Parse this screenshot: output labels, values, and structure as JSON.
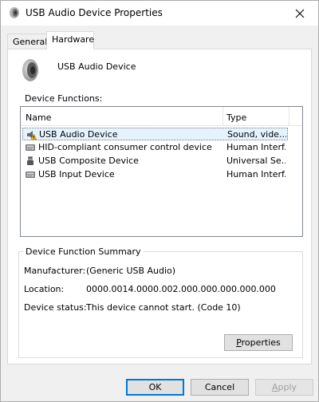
{
  "window": {
    "title": "USB Audio Device Properties",
    "title_icon": "speaker-icon",
    "close_icon": "close-icon"
  },
  "tabs": [
    {
      "label": "General",
      "active": false
    },
    {
      "label": "Hardware",
      "active": true
    }
  ],
  "device": {
    "icon": "speaker-icon",
    "name": "USB Audio Device"
  },
  "functions": {
    "label": "Device Functions:",
    "columns": {
      "name": "Name",
      "type": "Type"
    },
    "rows": [
      {
        "icon": "warning-audio-icon",
        "name": "USB Audio Device",
        "type": "Sound, vide...",
        "selected": true
      },
      {
        "icon": "hid-icon",
        "name": "HID-compliant consumer control device",
        "type": "Human Interf...",
        "selected": false
      },
      {
        "icon": "usb-icon",
        "name": "USB Composite Device",
        "type": "Universal Se...",
        "selected": false
      },
      {
        "icon": "hid-icon",
        "name": "USB Input Device",
        "type": "Human Interf...",
        "selected": false
      }
    ]
  },
  "summary": {
    "legend": "Device Function Summary",
    "manufacturer_label": "Manufacturer:",
    "manufacturer_value": "(Generic USB Audio)",
    "location_label": "Location:",
    "location_value": "0000.0014.0000.002.000.000.000.000.000",
    "status_label": "Device status:",
    "status_value": "This device cannot start. (Code 10)",
    "properties_button_pre": "",
    "properties_button_u": "P",
    "properties_button_post": "roperties"
  },
  "footer": {
    "ok": "OK",
    "cancel": "Cancel",
    "apply_u": "A",
    "apply_post": "pply"
  }
}
